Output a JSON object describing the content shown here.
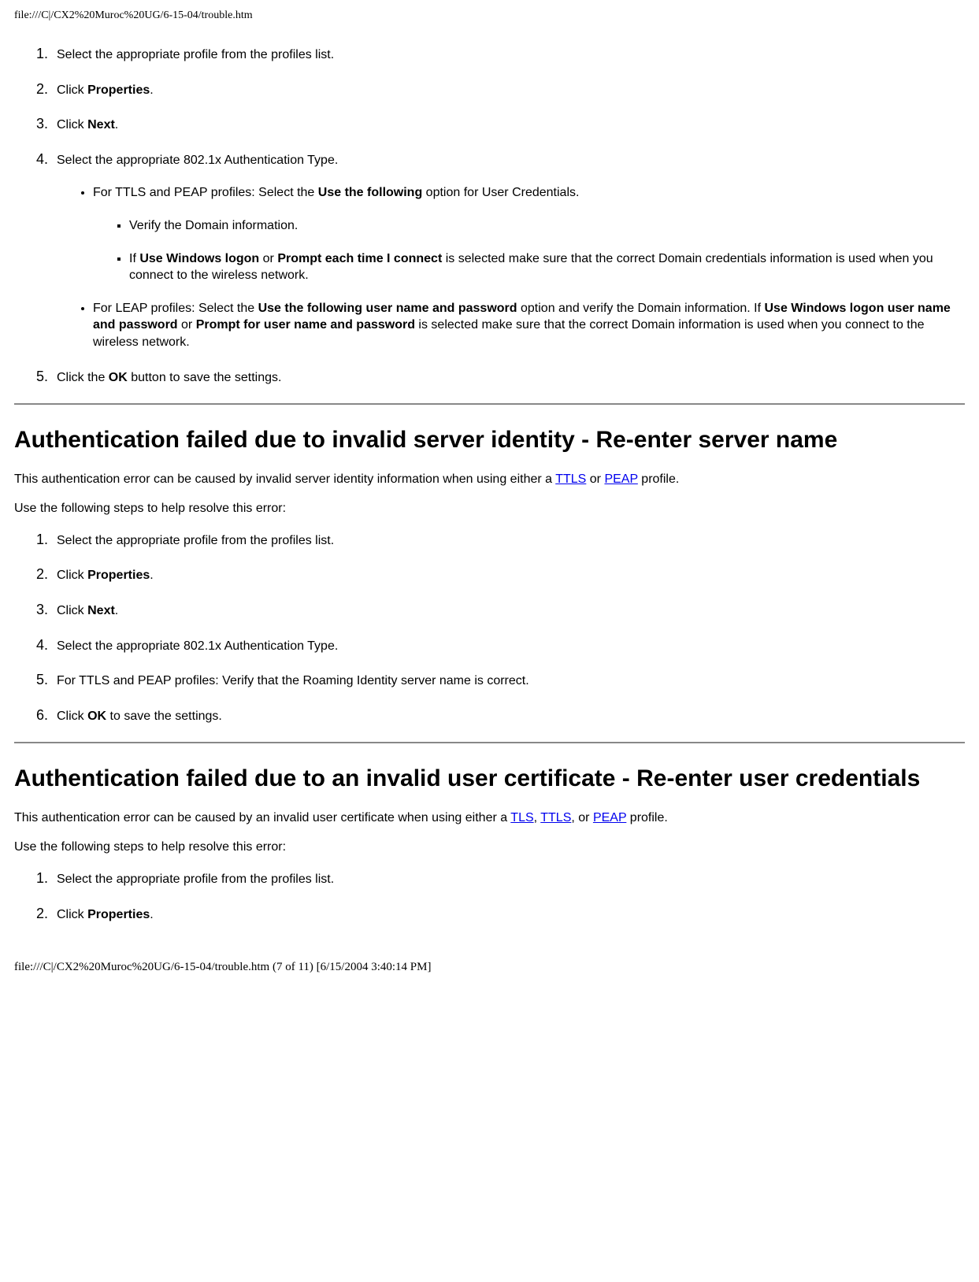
{
  "header_path": "file:///C|/CX2%20Muroc%20UG/6-15-04/trouble.htm",
  "section1": {
    "steps": [
      "Select the appropriate profile from the profiles list.",
      {
        "pre": "Click ",
        "bold": "Properties",
        "post": "."
      },
      {
        "pre": "Click ",
        "bold": "Next",
        "post": "."
      },
      "Select the appropriate 802.1x Authentication Type."
    ],
    "sub_bullets": {
      "ttls_peap": {
        "pre": "For TTLS and PEAP profiles: Select the ",
        "bold": "Use the following",
        "post": " option for User Credentials."
      },
      "verify_domain": "Verify the Domain information.",
      "windows_logon": {
        "t1": "If ",
        "b1": "Use Windows logon",
        "t2": " or ",
        "b2": "Prompt each time I connect",
        "t3": " is selected make sure that the correct Domain credentials information is used when you connect to the wireless network."
      },
      "leap": {
        "t1": "For LEAP profiles: Select the ",
        "b1": "Use the following user name and password",
        "t2": " option and verify the Domain information. If ",
        "b2": "Use Windows logon user name and password",
        "t3": " or ",
        "b3": "Prompt for user name and password",
        "t4": " is selected make sure that the correct Domain information is used when you connect to the wireless network."
      }
    },
    "step5": {
      "pre": "Click the ",
      "bold": "OK",
      "post": " button to save the settings."
    }
  },
  "section2": {
    "heading": "Authentication failed due to invalid server identity - Re-enter server name",
    "intro": {
      "t1": "This authentication error can be caused by invalid server identity information when using either a ",
      "link1": "TTLS",
      "t2": " or ",
      "link2": "PEAP",
      "t3": " profile."
    },
    "resolve_lead": "Use the following steps to help resolve this error:",
    "steps": [
      "Select the appropriate profile from the profiles list.",
      {
        "pre": "Click ",
        "bold": "Properties",
        "post": "."
      },
      {
        "pre": "Click ",
        "bold": "Next",
        "post": "."
      },
      "Select the appropriate 802.1x Authentication Type.",
      "For TTLS and PEAP profiles: Verify that the Roaming Identity server name is correct.",
      {
        "pre": "Click ",
        "bold": "OK",
        "post": " to save the settings."
      }
    ]
  },
  "section3": {
    "heading": "Authentication failed due to an invalid user certificate - Re-enter user credentials",
    "intro": {
      "t1": "This authentication error can be caused by an invalid user certificate when using either a ",
      "link1": "TLS",
      "t2": ", ",
      "link2": "TTLS",
      "t3": ", or ",
      "link3": "PEAP",
      "t4": " profile."
    },
    "resolve_lead": "Use the following steps to help resolve this error:",
    "steps": [
      "Select the appropriate profile from the profiles list.",
      {
        "pre": "Click ",
        "bold": "Properties",
        "post": "."
      }
    ]
  },
  "footer": "file:///C|/CX2%20Muroc%20UG/6-15-04/trouble.htm (7 of 11) [6/15/2004 3:40:14 PM]"
}
